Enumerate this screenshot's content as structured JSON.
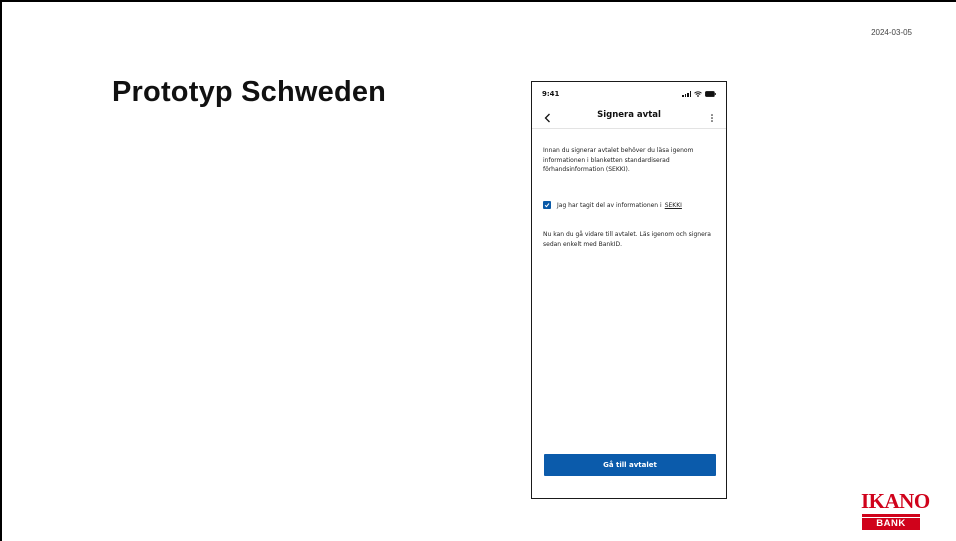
{
  "slide": {
    "date": "2024-03-05",
    "title": "Prototyp Schweden"
  },
  "phone": {
    "status_time": "9:41",
    "status_icons": [
      "signal-icon",
      "wifi-icon",
      "battery-icon"
    ],
    "nav": {
      "back_icon": "chevron-left-icon",
      "title": "Signera avtal",
      "menu_icon": "more-vertical-icon"
    },
    "info_text": "Innan du signerar avtalet behöver du läsa igenom informationen i blanketten standardiserad förhandsinformation (SEKKI).",
    "checkbox": {
      "checked": true,
      "label": "Jag har tagit del av informationen i",
      "link": "SEKKI"
    },
    "next_text": "Nu kan du gå vidare till avtalet. Läs igenom och signera sedan enkelt med BankID.",
    "button_label": "Gå till avtalet"
  },
  "logo": {
    "top": "IKANO",
    "bottom": "BANK",
    "color": "#d0021b"
  },
  "colors": {
    "accent": "#0b5bab",
    "brand": "#d0021b"
  }
}
